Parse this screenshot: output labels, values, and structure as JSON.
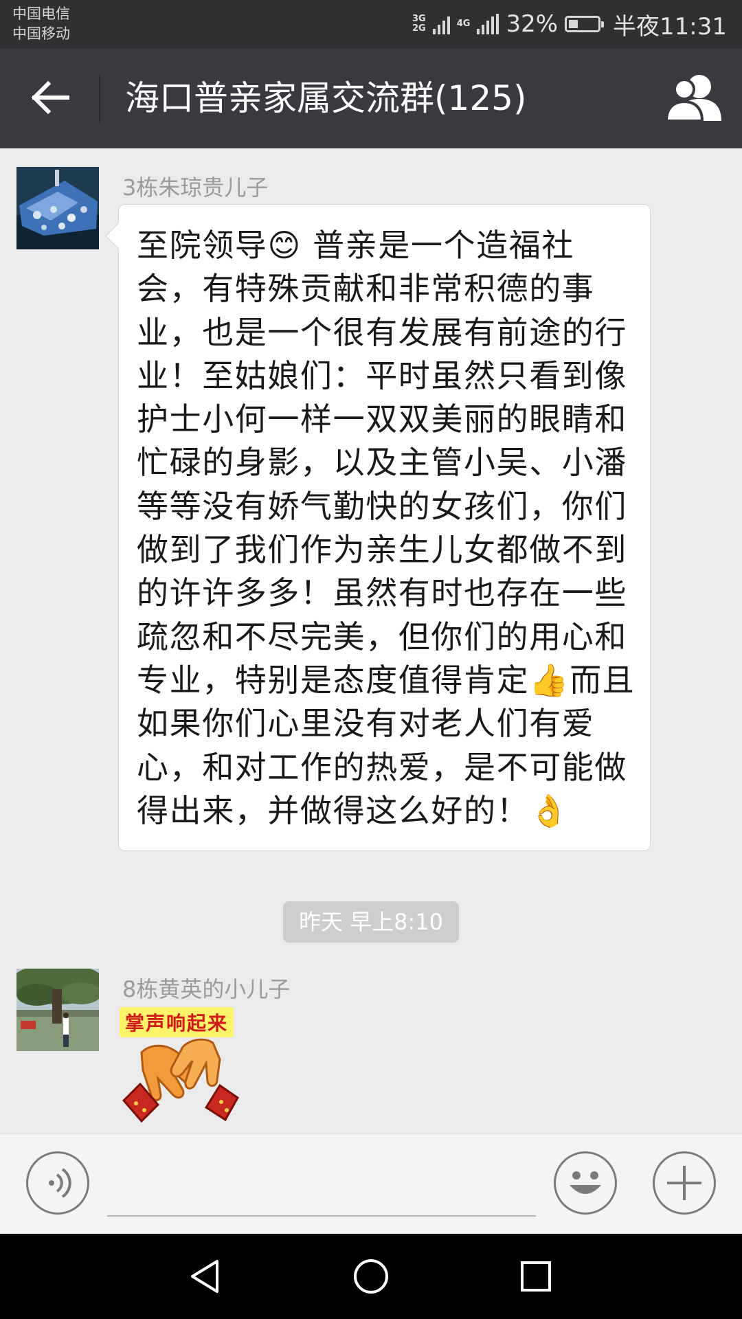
{
  "status_bar": {
    "carrier_1": "中国电信",
    "carrier_2": "中国移动",
    "network_1": "3G",
    "network_2": "2G",
    "network_3": "4G",
    "battery_percent": "32%",
    "battery_level": 0.32,
    "time": "半夜11:31"
  },
  "header": {
    "title": "海口普亲家属交流群(125)",
    "back_icon": "back-arrow-icon",
    "members_icon": "group-members-icon",
    "background": "#393a3f"
  },
  "messages": [
    {
      "sender": "3栋朱琼贵儿子",
      "text": "至院领导😊 普亲是一个造福社会，有特殊贡献和非常积德的事业，也是一个很有发展有前途的行业！至姑娘们：平时虽然只看到像护士小何一样一双双美丽的眼睛和忙碌的身影，以及主管小吴、小潘等等没有娇气勤快的女孩们，你们做到了我们作为亲生儿女都做不到的许许多多！虽然有时也存在一些疏忽和不尽完美，但你们的用心和专业，特别是态度值得肯定👍而且如果你们心里没有对老人们有爱心，和对工作的热爱，是不可能做得出来，并做得这么好的！👌"
    },
    {
      "sender": "8栋黄英的小儿子",
      "sticker_text": "掌声响起来",
      "sticker_icon": "applause-hands-icon"
    }
  ],
  "timestamp": "昨天 早上8:10",
  "input_bar": {
    "voice_icon": "voice-input-icon",
    "emoji_icon": "emoji-icon",
    "plus_icon": "plus-icon"
  },
  "nav_bar": {
    "back_icon": "nav-back-icon",
    "home_icon": "nav-home-icon",
    "recents_icon": "nav-recents-icon"
  }
}
